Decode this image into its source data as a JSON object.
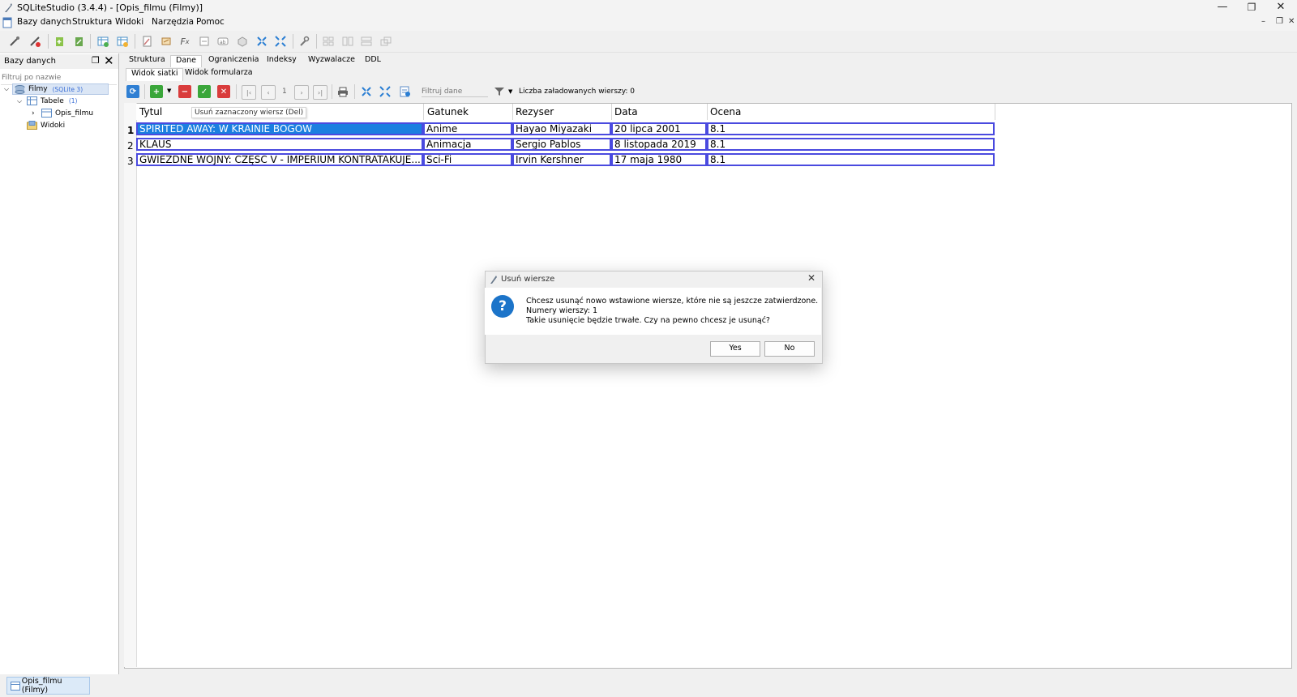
{
  "window": {
    "title": "SQLiteStudio (3.4.4) - [Opis_filmu (Filmy)]",
    "minimize": "—",
    "maximize": "❐",
    "close": "✕"
  },
  "menu": [
    "Bazy danych",
    "Struktura",
    "Widoki",
    "Narzędzia",
    "Pomoc"
  ],
  "left_panel": {
    "title": "Bazy danych",
    "filter_placeholder": "Filtruj po nazwie",
    "tree": {
      "db_name": "Filmy",
      "db_type": "(SQLite 3)",
      "tables_label": "Tabele",
      "tables_count": "(1)",
      "table_name": "Opis_filmu",
      "views_label": "Widoki"
    }
  },
  "tabs": [
    "Struktura",
    "Dane",
    "Ograniczenia",
    "Indeksy",
    "Wyzwalacze",
    "DDL"
  ],
  "active_tab": "Dane",
  "subtabs": [
    "Widok siatki",
    "Widok formularza"
  ],
  "data_toolbar": {
    "page_number": "1",
    "filter_placeholder": "Filtruj dane",
    "loaded_rows_text": "Liczba załadowanych wierszy: 0",
    "tooltip": "Usuń zaznaczony wiersz (Del)"
  },
  "grid": {
    "columns": [
      "Tytul",
      "Gatunek",
      "Rezyser",
      "Data",
      "Ocena"
    ],
    "rows": [
      {
        "num": "1",
        "cells": [
          "SPIRITED AWAY: W KRAINIE BOGÓW",
          "Anime",
          "Hayao Miyazaki",
          "20 lipca 2001",
          "8.1"
        ]
      },
      {
        "num": "2",
        "cells": [
          "KLAUS",
          "Animacja",
          "Sergio Pablos",
          "8 listopada 2019",
          "8.1"
        ]
      },
      {
        "num": "3",
        "cells": [
          "GWIEZDNE WOJNY: CZĘŚĆ V - IMPERIUM KONTRATAKUJE...",
          "Sci-Fi",
          "Irvin Kershner",
          "17 maja 1980",
          "8.1"
        ]
      }
    ],
    "selected_row": 1
  },
  "dialog": {
    "title": "Usuń wiersze",
    "icon": "question-icon",
    "line1": "Chcesz usunąć nowo wstawione wiersze, które nie są jeszcze zatwierdzone.",
    "line2": "Numery wierszy: 1",
    "line3": "Takie usunięcie będzie trwałe. Czy na pewno chcesz je usunąć?",
    "yes_label": "Yes",
    "no_label": "No"
  },
  "taskbar": {
    "window_button": "Opis_filmu (Filmy)"
  },
  "colors": {
    "selection": "#1b7fe0",
    "cell_border": "#4a4adf",
    "dialog_icon": "#1c74c9"
  }
}
